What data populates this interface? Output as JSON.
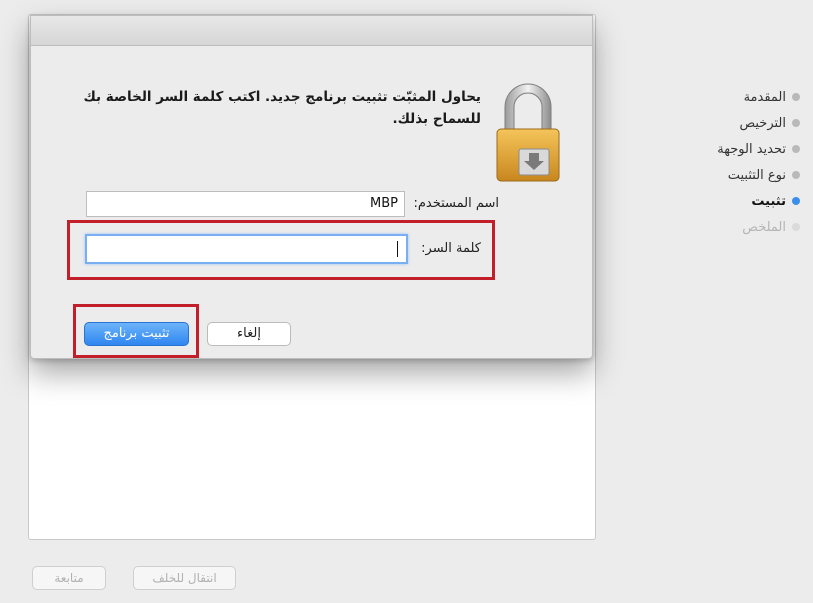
{
  "sidebar": {
    "steps": [
      {
        "label": "المقدمة",
        "state": "done"
      },
      {
        "label": "الترخيص",
        "state": "done"
      },
      {
        "label": "تحديد الوجهة",
        "state": "done"
      },
      {
        "label": "نوع التثبيت",
        "state": "done"
      },
      {
        "label": "تثبيت",
        "state": "active"
      },
      {
        "label": "الملخص",
        "state": "disabled"
      }
    ]
  },
  "dialog": {
    "message": "يحاول المثبّت تثبيت برنامج جديد. اكتب كلمة السر الخاصة بك للسماح بذلك.",
    "username_label": "اسم المستخدم:",
    "username_value": "MBP",
    "password_label": "كلمة السر:",
    "password_value": "",
    "cancel_label": "إلغاء",
    "install_label": "تثبيت برنامج",
    "icon": "lock-icon"
  },
  "footer": {
    "back_label": "انتقال للخلف",
    "continue_label": "متابعة"
  },
  "colors": {
    "accent": "#3b8fe8",
    "highlight": "#c21f2a",
    "background": "#ececec"
  }
}
